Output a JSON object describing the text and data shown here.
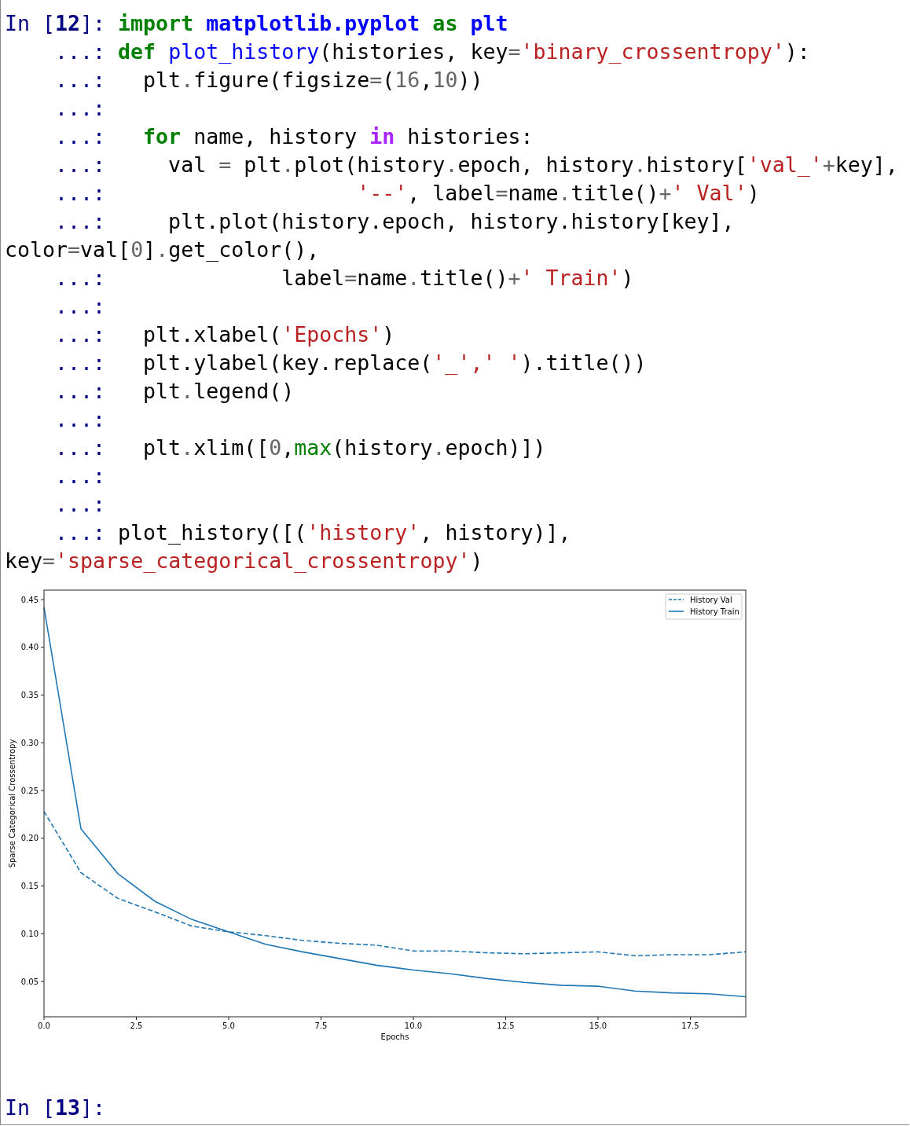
{
  "input_cell": {
    "lines": [
      {
        "prompt": "In [**12**]:",
        "tokens": [
          {
            "kind": "kw",
            "text": "import"
          },
          {
            "kind": "ns",
            "text": " matplotlib.pyplot"
          },
          {
            "kind": "kw",
            "text": " as"
          },
          {
            "kind": "ns",
            "text": " plt"
          }
        ]
      },
      {
        "prompt": "...:",
        "tokens": [
          {
            "kind": "kw",
            "text": "def"
          },
          {
            "kind": "fn",
            "text": " plot_history"
          },
          {
            "kind": "text",
            "text": "(histories, key"
          },
          {
            "kind": "op",
            "text": "="
          },
          {
            "kind": "str",
            "text": "'binary_crossentropy'"
          },
          {
            "kind": "text",
            "text": "):"
          }
        ]
      },
      {
        "prompt": "...:",
        "tokens": [
          {
            "kind": "text",
            "text": "  plt"
          },
          {
            "kind": "op",
            "text": "."
          },
          {
            "kind": "text",
            "text": "figure(figsize"
          },
          {
            "kind": "op",
            "text": "="
          },
          {
            "kind": "text",
            "text": "("
          },
          {
            "kind": "num",
            "text": "16"
          },
          {
            "kind": "text",
            "text": ","
          },
          {
            "kind": "num",
            "text": "10"
          },
          {
            "kind": "text",
            "text": "))"
          }
        ]
      },
      {
        "prompt": "...:"
      },
      {
        "prompt": "...:",
        "tokens": [
          {
            "kind": "kw",
            "text": "  for"
          },
          {
            "kind": "text",
            "text": " name, history "
          },
          {
            "kind": "ow",
            "text": "in"
          },
          {
            "kind": "text",
            "text": " histories:"
          }
        ]
      },
      {
        "prompt": "...:",
        "tokens": [
          {
            "kind": "text",
            "text": "    val "
          },
          {
            "kind": "op",
            "text": "="
          },
          {
            "kind": "text",
            "text": " plt"
          },
          {
            "kind": "op",
            "text": "."
          },
          {
            "kind": "text",
            "text": "plot(history"
          },
          {
            "kind": "op",
            "text": "."
          },
          {
            "kind": "text",
            "text": "epoch, history"
          },
          {
            "kind": "op",
            "text": "."
          },
          {
            "kind": "text",
            "text": "history["
          },
          {
            "kind": "str",
            "text": "'val_'"
          },
          {
            "kind": "op",
            "text": "+"
          },
          {
            "kind": "text",
            "text": "key],"
          }
        ]
      },
      {
        "prompt": "...:",
        "tokens": [
          {
            "kind": "str",
            "text": "                   '--'"
          },
          {
            "kind": "text",
            "text": ", label"
          },
          {
            "kind": "op",
            "text": "="
          },
          {
            "kind": "text",
            "text": "name"
          },
          {
            "kind": "op",
            "text": "."
          },
          {
            "kind": "text",
            "text": "title()"
          },
          {
            "kind": "op",
            "text": "+"
          },
          {
            "kind": "str",
            "text": "' Val'"
          },
          {
            "kind": "text",
            "text": ")"
          }
        ]
      },
      {
        "prompt": "...:",
        "tokens": [
          {
            "kind": "text",
            "text": "    plt.plot(history.epoch, history.history[key],"
          }
        ]
      },
      {
        "tokens": [
          {
            "kind": "text",
            "text": "color"
          },
          {
            "kind": "op",
            "text": "="
          },
          {
            "kind": "text",
            "text": "val["
          },
          {
            "kind": "num",
            "text": "0"
          },
          {
            "kind": "text",
            "text": "]"
          },
          {
            "kind": "op",
            "text": "."
          },
          {
            "kind": "text",
            "text": "get_color(),"
          }
        ]
      },
      {
        "prompt": "...:",
        "tokens": [
          {
            "kind": "text",
            "text": "             label"
          },
          {
            "kind": "op",
            "text": "="
          },
          {
            "kind": "text",
            "text": "name"
          },
          {
            "kind": "op",
            "text": "."
          },
          {
            "kind": "text",
            "text": "title()"
          },
          {
            "kind": "op",
            "text": "+"
          },
          {
            "kind": "str",
            "text": "' Train'"
          },
          {
            "kind": "text",
            "text": ")"
          }
        ]
      },
      {
        "prompt": "...:"
      },
      {
        "prompt": "...:",
        "tokens": [
          {
            "kind": "text",
            "text": "  plt.xlabel("
          },
          {
            "kind": "str",
            "text": "'Epochs'"
          },
          {
            "kind": "text",
            "text": ")"
          }
        ]
      },
      {
        "prompt": "...:",
        "tokens": [
          {
            "kind": "text",
            "text": "  plt.ylabel(key.replace("
          },
          {
            "kind": "str",
            "text": "'_',' '"
          },
          {
            "kind": "text",
            "text": ").title())"
          }
        ]
      },
      {
        "prompt": "...:",
        "tokens": [
          {
            "kind": "text",
            "text": "  plt"
          },
          {
            "kind": "op",
            "text": "."
          },
          {
            "kind": "text",
            "text": "legend()"
          }
        ]
      },
      {
        "prompt": "...:"
      },
      {
        "prompt": "...:",
        "tokens": [
          {
            "kind": "text",
            "text": "  plt"
          },
          {
            "kind": "op",
            "text": "."
          },
          {
            "kind": "text",
            "text": "xlim(["
          },
          {
            "kind": "num",
            "text": "0"
          },
          {
            "kind": "text",
            "text": ","
          },
          {
            "kind": "builtin",
            "text": "max"
          },
          {
            "kind": "text",
            "text": "(history"
          },
          {
            "kind": "op",
            "text": "."
          },
          {
            "kind": "text",
            "text": "epoch)])"
          }
        ]
      },
      {
        "prompt": "...:"
      },
      {
        "prompt": "...:"
      },
      {
        "prompt": "...:",
        "tokens": [
          {
            "kind": "text",
            "text": "plot_history([("
          },
          {
            "kind": "str",
            "text": "'history'"
          },
          {
            "kind": "text",
            "text": ", history)],"
          }
        ]
      },
      {
        "tokens": [
          {
            "kind": "text",
            "text": "key"
          },
          {
            "kind": "op",
            "text": "="
          },
          {
            "kind": "str",
            "text": "'sparse_categorical_crossentropy'"
          },
          {
            "kind": "text",
            "text": ")"
          }
        ]
      }
    ]
  },
  "output": {
    "chart_data": {
      "type": "line",
      "xlabel": "Epochs",
      "ylabel": "Sparse Categorical Crossentropy",
      "x": [
        0,
        1,
        2,
        3,
        4,
        5,
        6,
        7,
        8,
        9,
        10,
        11,
        12,
        13,
        14,
        15,
        16,
        17,
        18,
        19
      ],
      "series": [
        {
          "name": "History Val",
          "color": "#1f77b4",
          "line_style": "dashed",
          "values": [
            0.228,
            0.164,
            0.137,
            0.123,
            0.108,
            0.102,
            0.098,
            0.093,
            0.09,
            0.088,
            0.082,
            0.082,
            0.08,
            0.079,
            0.08,
            0.081,
            0.077,
            0.078,
            0.078,
            0.081
          ]
        },
        {
          "name": "History Train",
          "color": "#1f77b4",
          "line_style": "solid",
          "values": [
            0.442,
            0.21,
            0.163,
            0.134,
            0.115,
            0.102,
            0.089,
            0.081,
            0.074,
            0.067,
            0.062,
            0.058,
            0.053,
            0.049,
            0.046,
            0.045,
            0.04,
            0.038,
            0.037,
            0.034
          ]
        }
      ],
      "legend": true,
      "xlim": [
        0,
        19
      ],
      "ylim": [
        0.013,
        0.46
      ],
      "xticks": [
        {
          "value": 0,
          "label": "0.0"
        },
        {
          "value": 2.5,
          "label": "2.5"
        },
        {
          "value": 5,
          "label": "5.0"
        },
        {
          "value": 7.5,
          "label": "7.5"
        },
        {
          "value": 10,
          "label": "10.0"
        },
        {
          "value": 12.5,
          "label": "12.5"
        },
        {
          "value": 15,
          "label": "15.0"
        },
        {
          "value": 17.5,
          "label": "17.5"
        }
      ],
      "yticks": [
        {
          "value": 0.05,
          "label": "0.05"
        },
        {
          "value": 0.1,
          "label": "0.10"
        },
        {
          "value": 0.15,
          "label": "0.15"
        },
        {
          "value": 0.2,
          "label": "0.20"
        },
        {
          "value": 0.25,
          "label": "0.25"
        },
        {
          "value": 0.3,
          "label": "0.30"
        },
        {
          "value": 0.35,
          "label": "0.35"
        },
        {
          "value": 0.4,
          "label": "0.40"
        },
        {
          "value": 0.45,
          "label": "0.45"
        }
      ]
    }
  },
  "next_cell": {
    "prompt": "In [**13**]:"
  }
}
